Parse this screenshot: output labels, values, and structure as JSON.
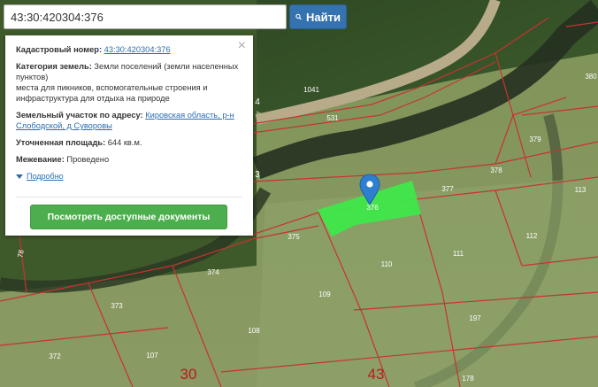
{
  "search": {
    "value": "43:30:420304:376",
    "button_label": "Найти"
  },
  "popup": {
    "cadastral_label": "Кадастровый номер:",
    "cadastral_value": "43:30:420304:376",
    "category_label": "Категория земель:",
    "category_value": "Земли поселений (земли населенных пунктов)",
    "category_value2": "места для пикников, вспомогательные строения и инфраструктура для отдыха на природе",
    "address_label": "Земельный участок по адресу:",
    "address_value": "Кировская область, р-н Слободской, д Суворовы",
    "area_label": "Уточненная площадь:",
    "area_value": "644 кв.м.",
    "survey_label": "Межевание:",
    "survey_value": "Проведено",
    "more_label": "Подробно",
    "docs_button": "Посмотреть доступные документы",
    "close": "×"
  },
  "map_labels": {
    "p1041": "1041",
    "p531": "531",
    "p379": "379",
    "p378": "378",
    "p377": "377",
    "p113": "113",
    "p376": "376",
    "p375": "375",
    "p112": "112",
    "p111": "111",
    "p110": "110",
    "p374": "374",
    "p109": "109",
    "p373": "373",
    "p197": "197",
    "p108": "108",
    "p372": "372",
    "p107": "107",
    "p178": "178",
    "p380": "380",
    "p4": "4",
    "p3": "3",
    "p78": "78",
    "q30": "30",
    "q43": "43"
  },
  "colors": {
    "parcel_border": "#c83232",
    "highlight": "#3fe84a",
    "marker": "#2f7fd1"
  }
}
